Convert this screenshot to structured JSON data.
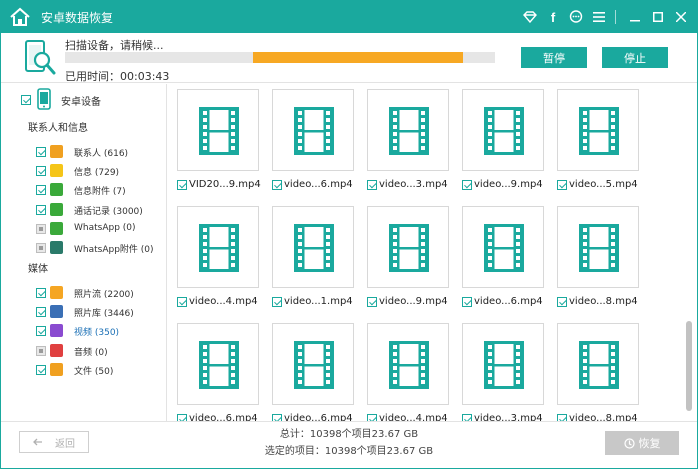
{
  "app": {
    "title": "安卓数据恢复",
    "accent_color": "#1aa99e",
    "titlebar_icons": [
      "diamond-icon",
      "facebook-icon",
      "chat-icon",
      "menu-icon",
      "minimize-icon",
      "maximize-icon",
      "close-icon"
    ]
  },
  "scan": {
    "status": "扫描设备，请稍候...",
    "elapsed": "已用时间：00:03:43",
    "progress_fraction": 0.52,
    "pause_label": "暂停",
    "stop_label": "停止"
  },
  "sidebar": {
    "device_label": "安卓设备",
    "sections": [
      {
        "title": "联系人和信息",
        "items": [
          {
            "label": "联系人 (616)",
            "icon": "contacts-icon",
            "color": "#f0a020",
            "checked": true,
            "disabled": false
          },
          {
            "label": "信息 (729)",
            "icon": "messages-icon",
            "color": "#f5c518",
            "checked": true,
            "disabled": false
          },
          {
            "label": "信息附件 (7)",
            "icon": "message-attachment-icon",
            "color": "#3aa93a",
            "checked": true,
            "disabled": false
          },
          {
            "label": "通话记录 (3000)",
            "icon": "call-log-icon",
            "color": "#3aa93a",
            "checked": true,
            "disabled": false
          },
          {
            "label": "WhatsApp (0)",
            "icon": "whatsapp-icon",
            "color": "#3aa93a",
            "checked": false,
            "disabled": true
          },
          {
            "label": "WhatsApp附件 (0)",
            "icon": "whatsapp-attachment-icon",
            "color": "#2a7a6a",
            "checked": false,
            "disabled": true
          }
        ]
      },
      {
        "title": "媒体",
        "items": [
          {
            "label": "照片流 (2200)",
            "icon": "photo-stream-icon",
            "color": "#f5a623",
            "checked": true,
            "disabled": false
          },
          {
            "label": "照片库 (3446)",
            "icon": "photo-library-icon",
            "color": "#3a6fb5",
            "checked": true,
            "disabled": false
          },
          {
            "label": "视频 (350)",
            "icon": "video-icon",
            "color": "#8a4bd0",
            "checked": true,
            "disabled": false,
            "selected": true
          },
          {
            "label": "音频 (0)",
            "icon": "audio-icon",
            "color": "#e04040",
            "checked": false,
            "disabled": true
          },
          {
            "label": "文件 (50)",
            "icon": "folder-icon",
            "color": "#f0a020",
            "checked": true,
            "disabled": false
          }
        ]
      }
    ]
  },
  "videos": [
    "VID20...9.mp4",
    "video...6.mp4",
    "video...3.mp4",
    "video...9.mp4",
    "video...5.mp4",
    "video...4.mp4",
    "video...1.mp4",
    "video...9.mp4",
    "video...6.mp4",
    "video...8.mp4",
    "video...6.mp4",
    "video...6.mp4",
    "video...4.mp4",
    "video...3.mp4",
    "video...8.mp4"
  ],
  "footer": {
    "back_label": "返回",
    "total": "总计：10398个项目23.67 GB",
    "selected": "选定的项目：10398个项目23.67 GB",
    "recover_label": "恢复"
  }
}
